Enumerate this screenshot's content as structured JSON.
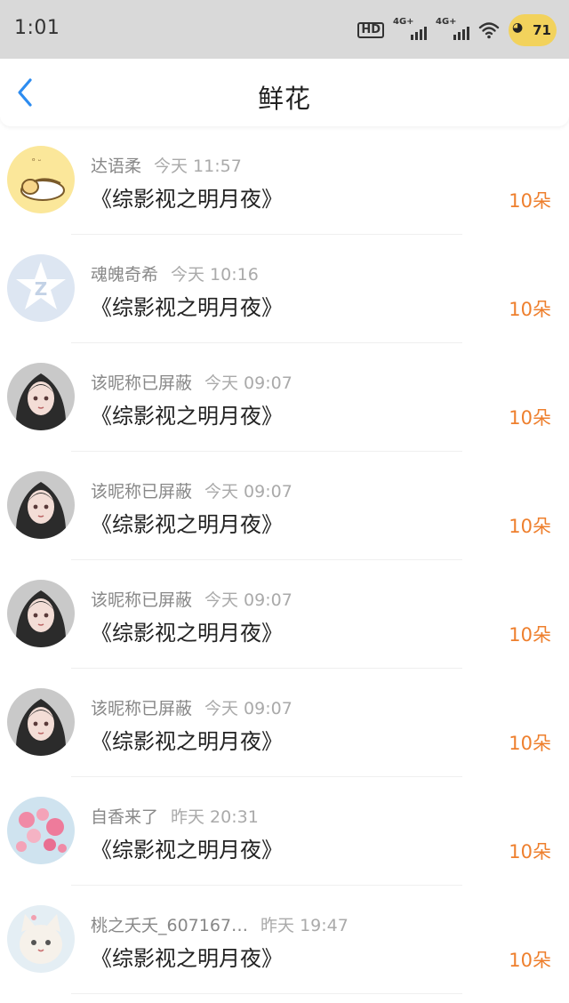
{
  "status": {
    "time": "1:01",
    "hd": "HD",
    "sim1": "4G+",
    "sim2": "4G+",
    "battery": "71"
  },
  "header": {
    "title": "鲜花"
  },
  "gifts": [
    {
      "name": "达语柔",
      "time": "今天 11:57",
      "work": "《综影视之明月夜》",
      "count": "10朵",
      "avatar": "yellow-sleeping-cat"
    },
    {
      "name": "魂魄奇希",
      "time": "今天 10:16",
      "work": "《综影视之明月夜》",
      "count": "10朵",
      "avatar": "default-blue-logo"
    },
    {
      "name": "该昵称已屏蔽",
      "time": "今天 09:07",
      "work": "《综影视之明月夜》",
      "count": "10朵",
      "avatar": "anime-girl"
    },
    {
      "name": "该昵称已屏蔽",
      "time": "今天 09:07",
      "work": "《综影视之明月夜》",
      "count": "10朵",
      "avatar": "anime-girl"
    },
    {
      "name": "该昵称已屏蔽",
      "time": "今天 09:07",
      "work": "《综影视之明月夜》",
      "count": "10朵",
      "avatar": "anime-girl"
    },
    {
      "name": "该昵称已屏蔽",
      "time": "今天 09:07",
      "work": "《综影视之明月夜》",
      "count": "10朵",
      "avatar": "anime-girl"
    },
    {
      "name": "自香来了",
      "time": "昨天 20:31",
      "work": "《综影视之明月夜》",
      "count": "10朵",
      "avatar": "pink-blossoms"
    },
    {
      "name": "桃之夭夭_607167…",
      "time": "昨天 19:47",
      "work": "《综影视之明月夜》",
      "count": "10朵",
      "avatar": "white-cat"
    }
  ],
  "colors": {
    "accent": "#ee7f2d",
    "back": "#2d8cf0"
  }
}
